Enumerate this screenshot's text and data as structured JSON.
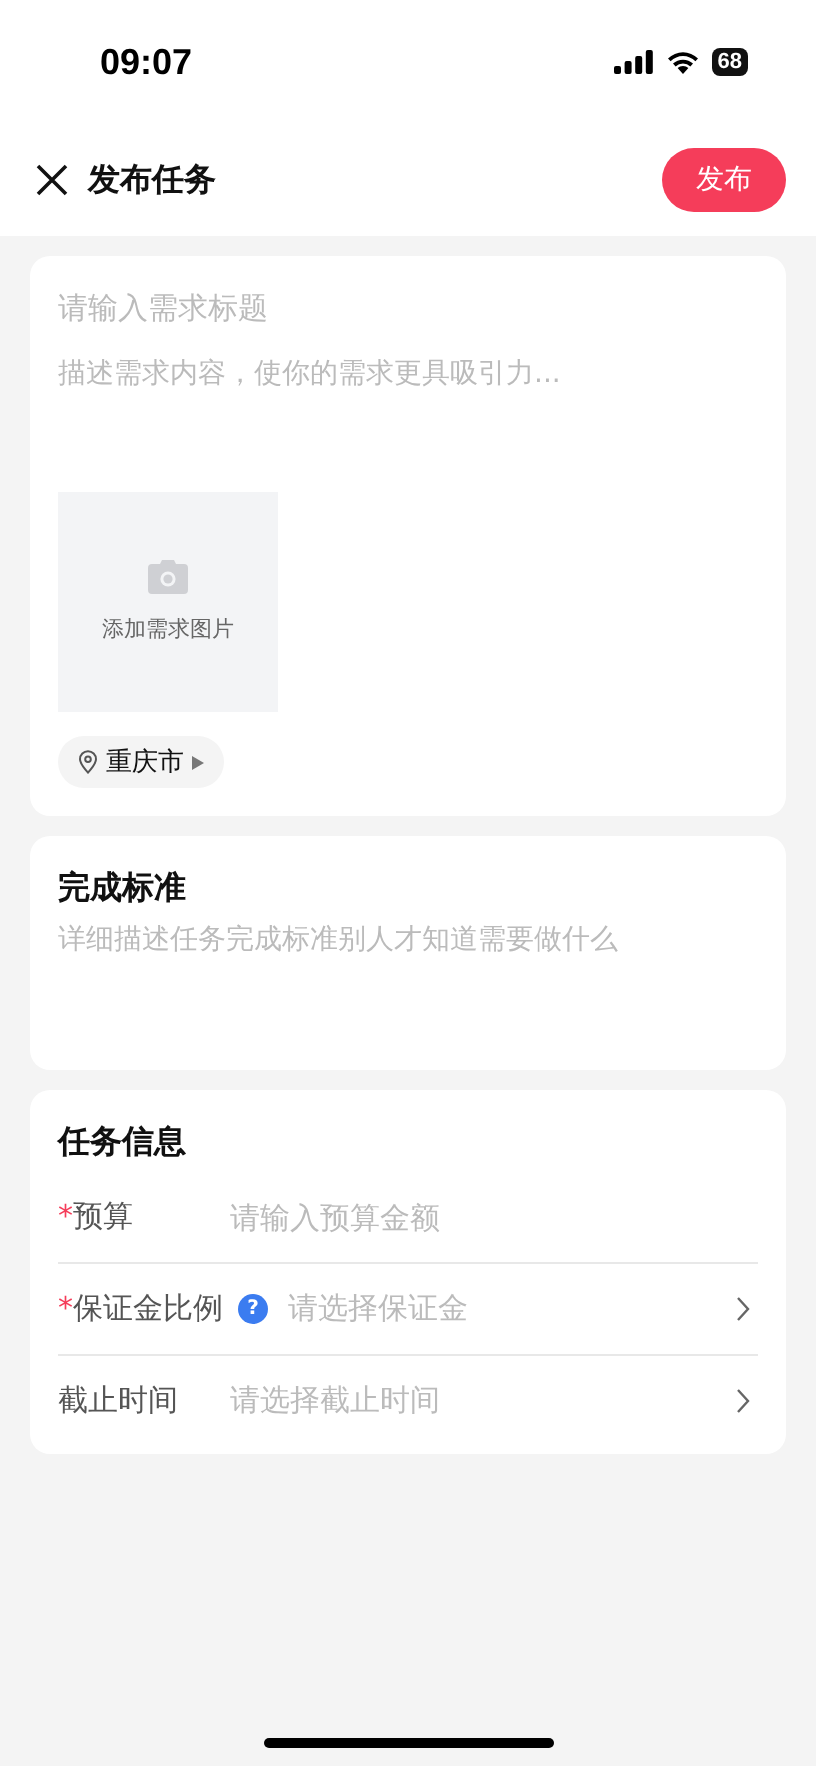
{
  "status_bar": {
    "time": "09:07",
    "battery": "68"
  },
  "nav": {
    "title": "发布任务",
    "publish_button": "发布"
  },
  "demand": {
    "title_placeholder": "请输入需求标题",
    "content_placeholder": "描述需求内容，使你的需求更具吸引力...",
    "add_image": "添加需求图片",
    "location": "重庆市"
  },
  "criteria": {
    "title": "完成标准",
    "placeholder": "详细描述任务完成标准别人才知道需要做什么"
  },
  "task_info": {
    "title": "任务信息",
    "rows": [
      {
        "kind": "input",
        "marker": "*",
        "label": "预算",
        "placeholder": "请输入预算金额"
      },
      {
        "kind": "select",
        "marker": "*",
        "label": "保证金比例",
        "help": "?",
        "placeholder": "请选择保证金"
      },
      {
        "kind": "select",
        "label": "截止时间",
        "placeholder": "请选择截止时间"
      }
    ]
  }
}
